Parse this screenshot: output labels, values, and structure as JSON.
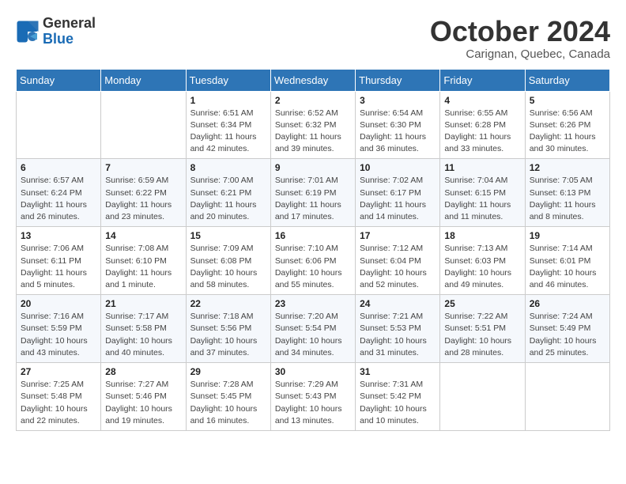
{
  "header": {
    "logo_line1": "General",
    "logo_line2": "Blue",
    "month_title": "October 2024",
    "location": "Carignan, Quebec, Canada"
  },
  "days_of_week": [
    "Sunday",
    "Monday",
    "Tuesday",
    "Wednesday",
    "Thursday",
    "Friday",
    "Saturday"
  ],
  "weeks": [
    [
      {
        "day": "",
        "info": ""
      },
      {
        "day": "",
        "info": ""
      },
      {
        "day": "1",
        "info": "Sunrise: 6:51 AM\nSunset: 6:34 PM\nDaylight: 11 hours and 42 minutes."
      },
      {
        "day": "2",
        "info": "Sunrise: 6:52 AM\nSunset: 6:32 PM\nDaylight: 11 hours and 39 minutes."
      },
      {
        "day": "3",
        "info": "Sunrise: 6:54 AM\nSunset: 6:30 PM\nDaylight: 11 hours and 36 minutes."
      },
      {
        "day": "4",
        "info": "Sunrise: 6:55 AM\nSunset: 6:28 PM\nDaylight: 11 hours and 33 minutes."
      },
      {
        "day": "5",
        "info": "Sunrise: 6:56 AM\nSunset: 6:26 PM\nDaylight: 11 hours and 30 minutes."
      }
    ],
    [
      {
        "day": "6",
        "info": "Sunrise: 6:57 AM\nSunset: 6:24 PM\nDaylight: 11 hours and 26 minutes."
      },
      {
        "day": "7",
        "info": "Sunrise: 6:59 AM\nSunset: 6:22 PM\nDaylight: 11 hours and 23 minutes."
      },
      {
        "day": "8",
        "info": "Sunrise: 7:00 AM\nSunset: 6:21 PM\nDaylight: 11 hours and 20 minutes."
      },
      {
        "day": "9",
        "info": "Sunrise: 7:01 AM\nSunset: 6:19 PM\nDaylight: 11 hours and 17 minutes."
      },
      {
        "day": "10",
        "info": "Sunrise: 7:02 AM\nSunset: 6:17 PM\nDaylight: 11 hours and 14 minutes."
      },
      {
        "day": "11",
        "info": "Sunrise: 7:04 AM\nSunset: 6:15 PM\nDaylight: 11 hours and 11 minutes."
      },
      {
        "day": "12",
        "info": "Sunrise: 7:05 AM\nSunset: 6:13 PM\nDaylight: 11 hours and 8 minutes."
      }
    ],
    [
      {
        "day": "13",
        "info": "Sunrise: 7:06 AM\nSunset: 6:11 PM\nDaylight: 11 hours and 5 minutes."
      },
      {
        "day": "14",
        "info": "Sunrise: 7:08 AM\nSunset: 6:10 PM\nDaylight: 11 hours and 1 minute."
      },
      {
        "day": "15",
        "info": "Sunrise: 7:09 AM\nSunset: 6:08 PM\nDaylight: 10 hours and 58 minutes."
      },
      {
        "day": "16",
        "info": "Sunrise: 7:10 AM\nSunset: 6:06 PM\nDaylight: 10 hours and 55 minutes."
      },
      {
        "day": "17",
        "info": "Sunrise: 7:12 AM\nSunset: 6:04 PM\nDaylight: 10 hours and 52 minutes."
      },
      {
        "day": "18",
        "info": "Sunrise: 7:13 AM\nSunset: 6:03 PM\nDaylight: 10 hours and 49 minutes."
      },
      {
        "day": "19",
        "info": "Sunrise: 7:14 AM\nSunset: 6:01 PM\nDaylight: 10 hours and 46 minutes."
      }
    ],
    [
      {
        "day": "20",
        "info": "Sunrise: 7:16 AM\nSunset: 5:59 PM\nDaylight: 10 hours and 43 minutes."
      },
      {
        "day": "21",
        "info": "Sunrise: 7:17 AM\nSunset: 5:58 PM\nDaylight: 10 hours and 40 minutes."
      },
      {
        "day": "22",
        "info": "Sunrise: 7:18 AM\nSunset: 5:56 PM\nDaylight: 10 hours and 37 minutes."
      },
      {
        "day": "23",
        "info": "Sunrise: 7:20 AM\nSunset: 5:54 PM\nDaylight: 10 hours and 34 minutes."
      },
      {
        "day": "24",
        "info": "Sunrise: 7:21 AM\nSunset: 5:53 PM\nDaylight: 10 hours and 31 minutes."
      },
      {
        "day": "25",
        "info": "Sunrise: 7:22 AM\nSunset: 5:51 PM\nDaylight: 10 hours and 28 minutes."
      },
      {
        "day": "26",
        "info": "Sunrise: 7:24 AM\nSunset: 5:49 PM\nDaylight: 10 hours and 25 minutes."
      }
    ],
    [
      {
        "day": "27",
        "info": "Sunrise: 7:25 AM\nSunset: 5:48 PM\nDaylight: 10 hours and 22 minutes."
      },
      {
        "day": "28",
        "info": "Sunrise: 7:27 AM\nSunset: 5:46 PM\nDaylight: 10 hours and 19 minutes."
      },
      {
        "day": "29",
        "info": "Sunrise: 7:28 AM\nSunset: 5:45 PM\nDaylight: 10 hours and 16 minutes."
      },
      {
        "day": "30",
        "info": "Sunrise: 7:29 AM\nSunset: 5:43 PM\nDaylight: 10 hours and 13 minutes."
      },
      {
        "day": "31",
        "info": "Sunrise: 7:31 AM\nSunset: 5:42 PM\nDaylight: 10 hours and 10 minutes."
      },
      {
        "day": "",
        "info": ""
      },
      {
        "day": "",
        "info": ""
      }
    ]
  ]
}
